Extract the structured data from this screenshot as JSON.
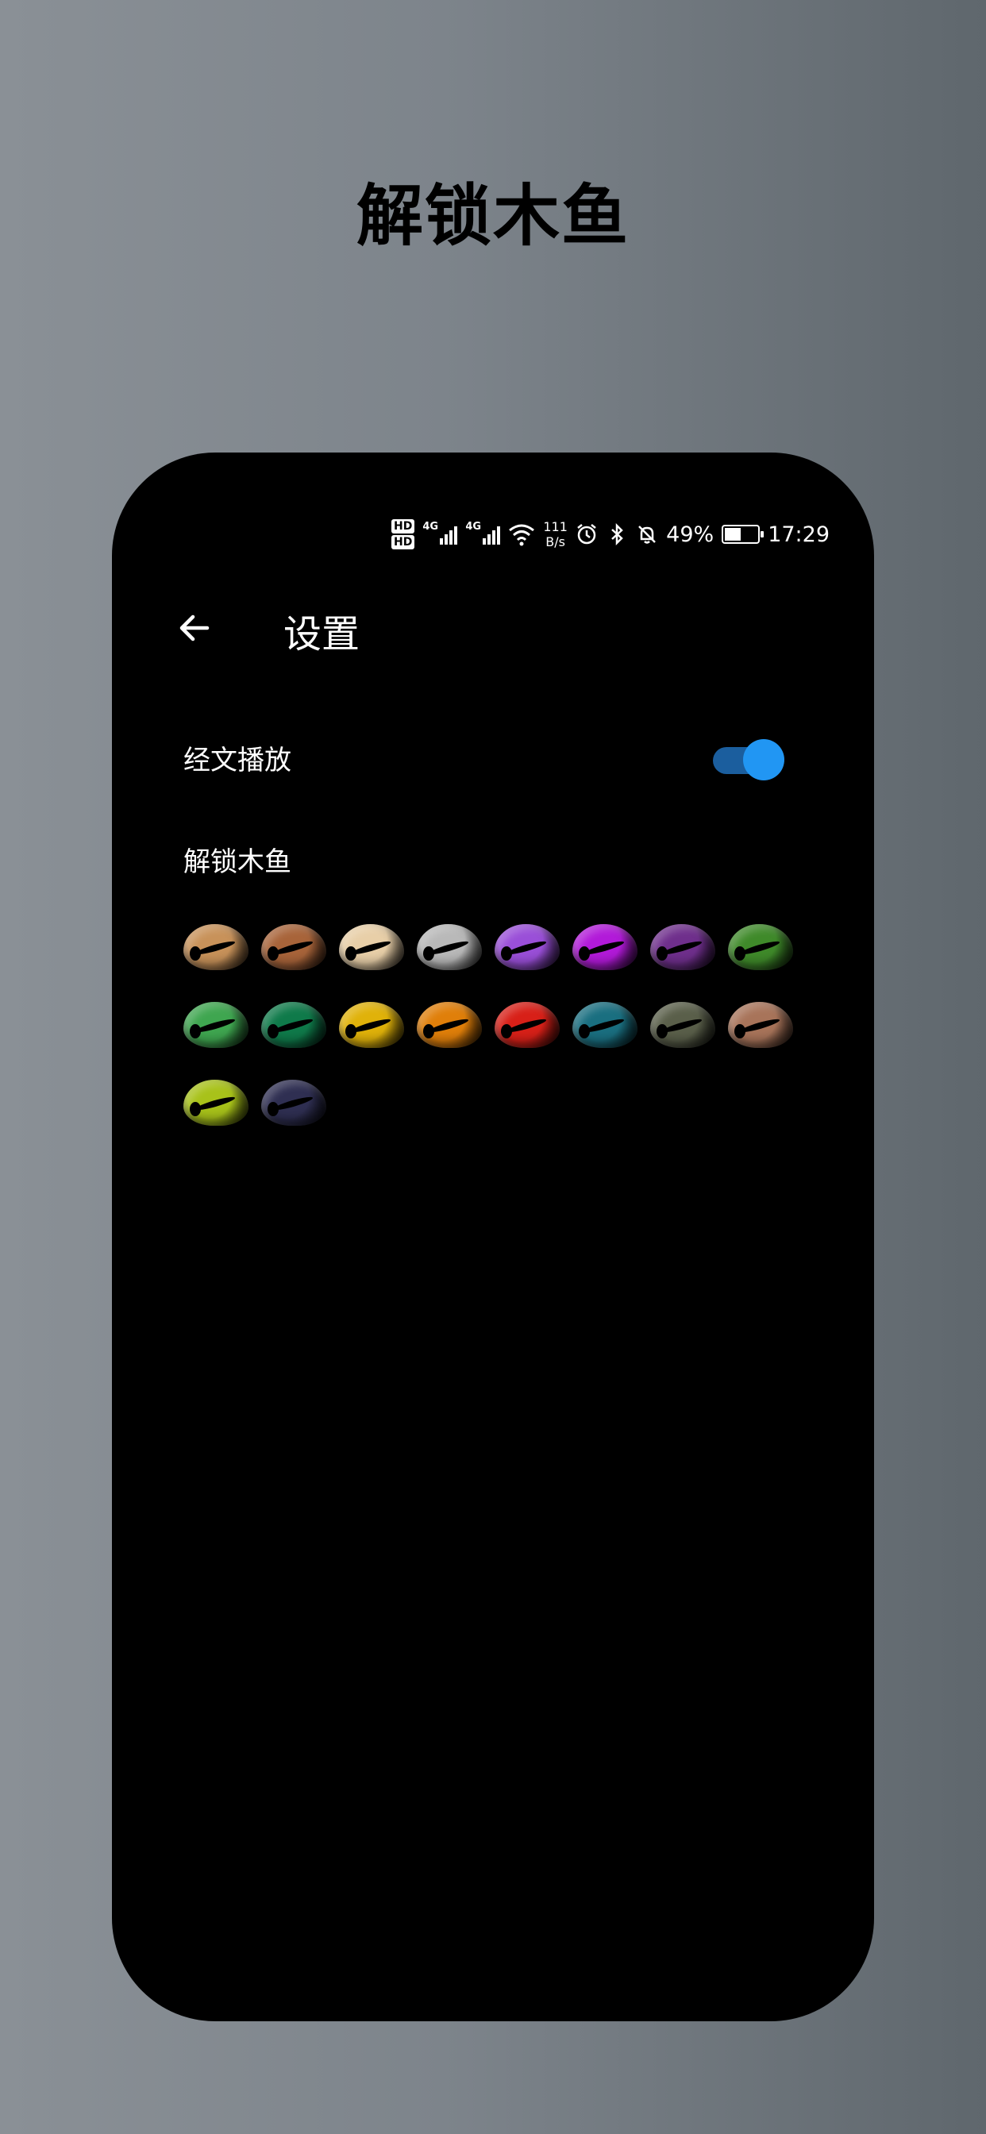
{
  "promo": {
    "title": "解锁木鱼"
  },
  "status_bar": {
    "hd1": "HD",
    "hd2": "HD",
    "sig1": "4G",
    "sig2": "4G",
    "speed_value": "111",
    "speed_unit": "B/s",
    "battery": "49%",
    "time": "17:29",
    "icons": [
      "hd-icon",
      "signal-icon",
      "signal-icon",
      "wifi-icon",
      "alarm-icon",
      "bluetooth-icon",
      "mute-bell-icon",
      "battery-icon"
    ]
  },
  "app_bar": {
    "title": "设置",
    "back_icon": "arrow-left-icon"
  },
  "settings": {
    "scripture_playback": {
      "label": "经文播放",
      "enabled": true
    },
    "unlock_fish": {
      "label": "解锁木鱼"
    }
  },
  "fish_colors": [
    "#c8925a",
    "#a8643a",
    "#e8cfa8",
    "#b9b9b9",
    "#9a4fd8",
    "#b21ad9",
    "#6f2f8c",
    "#3f8a2a",
    "#3fa650",
    "#0f7a4a",
    "#e0b20a",
    "#e07f0a",
    "#d82018",
    "#1a6f80",
    "#5a5f4a",
    "#a8745a",
    "#a8c21a",
    "#2f2f52"
  ],
  "colors": {
    "accent": "#2196f3",
    "accent_track": "#1b5e9e",
    "background": "#000000"
  }
}
